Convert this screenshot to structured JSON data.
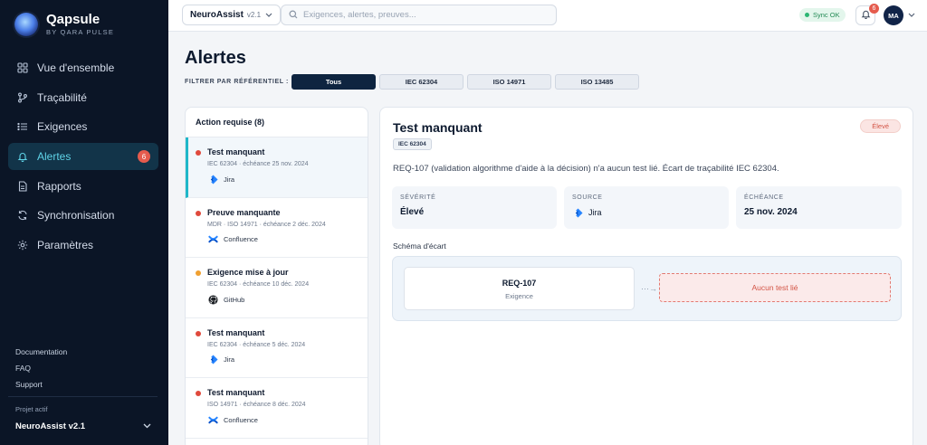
{
  "brand": {
    "name": "Qapsule",
    "subtitle": "BY QARA PULSE"
  },
  "sidebar": {
    "items": [
      {
        "label": "Vue d'ensemble",
        "icon": "grid-icon"
      },
      {
        "label": "Traçabilité",
        "icon": "branch-icon"
      },
      {
        "label": "Exigences",
        "icon": "list-icon"
      },
      {
        "label": "Alertes",
        "icon": "bell-icon",
        "badge": "6",
        "active": true
      },
      {
        "label": "Rapports",
        "icon": "document-icon"
      },
      {
        "label": "Synchronisation",
        "icon": "sync-icon"
      },
      {
        "label": "Paramètres",
        "icon": "gear-icon"
      }
    ],
    "links": [
      "Documentation",
      "FAQ",
      "Support"
    ],
    "project_label": "Projet actif",
    "project_name": "NeuroAssist v2.1"
  },
  "topbar": {
    "project_name": "NeuroAssist",
    "project_version": "v2.1",
    "search_placeholder": "Exigences, alertes, preuves...",
    "sync_label": "Sync OK",
    "notification_count": "6",
    "avatar_initials": "MA"
  },
  "page": {
    "title": "Alertes",
    "filter_label": "FILTRER PAR RÉFÉRENTIEL :",
    "filters": [
      "Tous",
      "IEC 62304",
      "ISO 14971",
      "ISO 13485"
    ],
    "active_filter": "Tous"
  },
  "alert_list": {
    "header": "Action requise (8)",
    "items": [
      {
        "title": "Test manquant",
        "meta": "IEC 62304 · échéance 25 nov. 2024",
        "source": "Jira",
        "severity_color": "#e0493c"
      },
      {
        "title": "Preuve manquante",
        "meta": "MDR · ISO 14971 · échéance 2 déc. 2024",
        "source": "Confluence",
        "severity_color": "#e0493c"
      },
      {
        "title": "Exigence mise à jour",
        "meta": "IEC 62304 · échéance 10 déc. 2024",
        "source": "GitHub",
        "severity_color": "#f0a030"
      },
      {
        "title": "Test manquant",
        "meta": "IEC 62304 · échéance 5 déc. 2024",
        "source": "Jira",
        "severity_color": "#e0493c"
      },
      {
        "title": "Test manquant",
        "meta": "ISO 14971 · échéance 8 déc. 2024",
        "source": "Confluence",
        "severity_color": "#e0493c"
      }
    ]
  },
  "detail": {
    "title": "Test manquant",
    "tag": "IEC 62304",
    "severity_badge": "Élevé",
    "description": "REQ-107 (validation algorithme d'aide à la décision) n'a aucun test lié. Écart de traçabilité IEC 62304.",
    "cards": {
      "severity": {
        "label": "SÉVÉRITÉ",
        "value": "Élevé"
      },
      "source": {
        "label": "SOURCE",
        "value": "Jira"
      },
      "due": {
        "label": "ÉCHÉANCE",
        "value": "25 nov. 2024"
      }
    },
    "schema_label": "Schéma d'écart",
    "schema": {
      "req_id": "REQ-107",
      "req_type": "Exigence",
      "arrow": "···→",
      "missing": "Aucun test lié"
    }
  }
}
